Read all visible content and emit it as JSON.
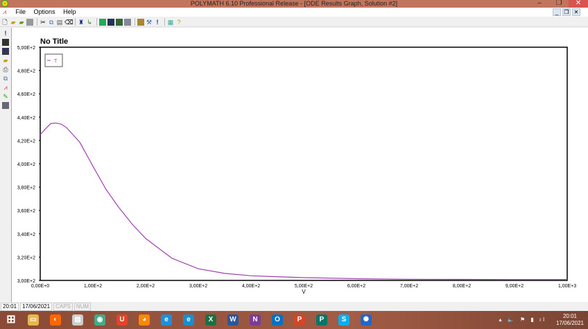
{
  "window": {
    "title": "POLYMATH 6.10 Professional Release - [ODE Results Graph, Solution #2]",
    "minimize": "–",
    "maximize": "❐",
    "close": "✕"
  },
  "menu": [
    "File",
    "Options",
    "Help"
  ],
  "mdi_controls": [
    "_",
    "❐",
    "✕"
  ],
  "status": {
    "time": "20:01",
    "date": "17/06/2021",
    "caps": "CAPS",
    "num": "NUM"
  },
  "taskbar": {
    "apps": [
      "Start",
      "File Explorer",
      "Photos",
      "Notepad",
      "Chrome",
      "Office",
      "Firefox",
      "Internet Explorer",
      "Edge",
      "Excel",
      "Word",
      "OneNote",
      "Outlook",
      "PowerPoint",
      "Publisher",
      "Skype",
      "Polymath"
    ],
    "clock_time": "20:01",
    "clock_date": "17/06/2021"
  },
  "chart_data": {
    "type": "line",
    "title": "No Title",
    "xlabel": "V",
    "ylabel": "",
    "xlim": [
      0,
      1000
    ],
    "ylim": [
      300,
      500
    ],
    "xticks": [
      "0,00E+0",
      "1,00E+2",
      "2,00E+2",
      "3,00E+2",
      "4,00E+2",
      "5,00E+2",
      "6,00E+2",
      "7,00E+2",
      "8,00E+2",
      "9,00E+2",
      "1,00E+3"
    ],
    "yticks": [
      "3,00E+2",
      "3,20E+2",
      "3,40E+2",
      "3,60E+2",
      "3,80E+2",
      "4,00E+2",
      "4,20E+2",
      "4,40E+2",
      "4,60E+2",
      "4,80E+2",
      "5,00E+2"
    ],
    "legend": {
      "position": "top-left",
      "entries": [
        "T"
      ]
    },
    "series": [
      {
        "name": "T",
        "color": "#a040b0",
        "x": [
          0,
          10,
          20,
          30,
          40,
          50,
          75,
          100,
          125,
          150,
          175,
          200,
          250,
          300,
          350,
          400,
          500,
          600,
          700,
          800,
          900,
          1000
        ],
        "y": [
          425,
          430,
          434.5,
          435,
          434,
          431,
          418.5,
          398,
          378,
          362,
          348,
          336,
          319,
          310,
          306,
          304,
          302.4,
          301.5,
          301,
          300.9,
          300.8,
          300.8
        ]
      }
    ]
  }
}
